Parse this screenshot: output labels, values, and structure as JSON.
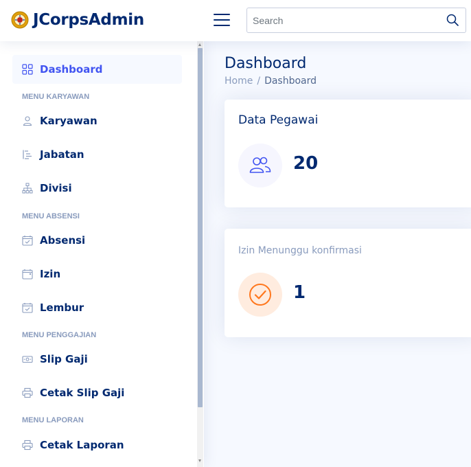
{
  "header": {
    "brand": "JCorpsAdmin",
    "logo_icon": "logo-emblem-icon",
    "toggle_icon": "hamburger-menu-icon",
    "search": {
      "placeholder": "Search",
      "value": "",
      "icon": "search-icon"
    }
  },
  "sidebar": {
    "items": [
      {
        "label": "Dashboard",
        "icon": "grid-icon",
        "active": true
      },
      {
        "label": "Karyawan",
        "icon": "person-icon"
      },
      {
        "label": "Jabatan",
        "icon": "hierarchy-list-icon"
      },
      {
        "label": "Divisi",
        "icon": "org-chart-icon"
      },
      {
        "label": "Absensi",
        "icon": "calendar-check-icon"
      },
      {
        "label": "Izin",
        "icon": "calendar-icon"
      },
      {
        "label": "Lembur",
        "icon": "calendar-check-icon"
      },
      {
        "label": "Slip Gaji",
        "icon": "cash-icon"
      },
      {
        "label": "Cetak Slip Gaji",
        "icon": "printer-icon"
      },
      {
        "label": "Cetak Laporan",
        "icon": "printer-icon"
      }
    ],
    "headings": [
      "MENU KARYAWAN",
      "MENU ABSENSI",
      "MENU PENGGAJIAN",
      "MENU LAPORAN"
    ]
  },
  "main": {
    "title": "Dashboard",
    "breadcrumb": {
      "home": "Home",
      "separator": "/",
      "current": "Dashboard"
    },
    "cards": [
      {
        "title": "Data Pegawai",
        "value": "20",
        "icon": "people-icon",
        "icon_color": "#4154f1"
      },
      {
        "title": "Izin Menunggu konfirmasi",
        "value": "1",
        "icon": "check-circle-icon",
        "icon_color": "#ff771d"
      }
    ]
  },
  "colors": {
    "primary": "#4154f1",
    "navy": "#012970",
    "muted": "#899bbd",
    "orange": "#ff771d"
  }
}
